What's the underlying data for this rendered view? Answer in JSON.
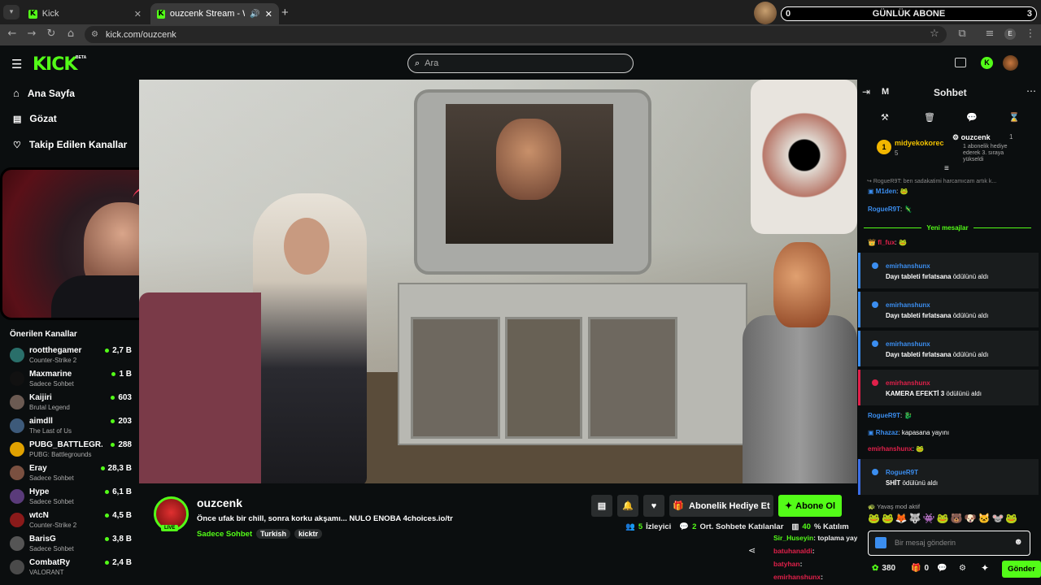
{
  "browser": {
    "tabs": [
      {
        "title": "Kick"
      },
      {
        "title": "ouzcenk Stream - Watch Li"
      }
    ],
    "url": "kick.com/ouzcenk",
    "profile_letter": "E"
  },
  "overlay": {
    "subs_left": "0",
    "subs_title": "GÜNLÜK ABONE",
    "subs_right": "3"
  },
  "header": {
    "logo": "KICK",
    "beta": "BETA",
    "search_placeholder": "Ara"
  },
  "sidebar": {
    "nav": [
      {
        "label": "Ana Sayfa"
      },
      {
        "label": "Gözat"
      },
      {
        "label": "Takip Edilen Kanallar"
      }
    ],
    "recommended_title": "Önerilen Kanallar",
    "channels": [
      {
        "name": "rootthegamer",
        "category": "Counter-Strike 2",
        "viewers": "2,7 B",
        "color": "#2a6f6a"
      },
      {
        "name": "Maxmarine",
        "category": "Sadece Sohbet",
        "viewers": "1 B",
        "color": "#111"
      },
      {
        "name": "Kaijiri",
        "category": "Brutal Legend",
        "viewers": "603",
        "color": "#6b5a52"
      },
      {
        "name": "aimdll",
        "category": "The Last of Us",
        "viewers": "203",
        "color": "#3d5a7a"
      },
      {
        "name": "PUBG_BATTLEGR...",
        "category": "PUBG: Battlegrounds",
        "viewers": "288",
        "color": "#e0a100"
      },
      {
        "name": "Eray",
        "category": "Sadece Sohbet",
        "viewers": "28,3 B",
        "color": "#7a5040"
      },
      {
        "name": "Hype",
        "category": "Sadece Sohbet",
        "viewers": "6,1 B",
        "color": "#5a3b7a"
      },
      {
        "name": "wtcN",
        "category": "Counter-Strike 2",
        "viewers": "4,5 B",
        "color": "#8a1a1a"
      },
      {
        "name": "BarisG",
        "category": "Sadece Sohbet",
        "viewers": "3,8 B",
        "color": "#555"
      },
      {
        "name": "CombatRy",
        "category": "VALORANT",
        "viewers": "2,4 B",
        "color": "#4a4a4a"
      }
    ]
  },
  "stream": {
    "username": "ouzcenk",
    "live": "LIVE",
    "title": "Önce ufak bir chill, sonra korku akşamı... NULO ENOBA 4choices.io/tr",
    "category": "Sadece Sohbet",
    "tags": [
      "Turkish",
      "kicktr"
    ],
    "gift_label": "Abonelik Hediye Et",
    "subscribe_label": "Abone Ol",
    "viewers": "5",
    "viewers_label": "İzleyici",
    "avg_chatters": "2",
    "avg_label": "Ort. Sohbete Katılanlar",
    "participation": "40",
    "participation_label": "% Katılım"
  },
  "chat": {
    "title": "Sohbet",
    "m_label": "M",
    "pinned": {
      "user1": "midyekokorec",
      "n1": "5",
      "user2": "ouzcenk",
      "n2": "1",
      "note": "1 abonelik hediye ederek 3. sıraya yükseldi"
    },
    "reply_preview": "RogueR9T: ben sadakatimi harcamıcam artık k...",
    "msg_m1den": "M1den",
    "msg_rogue1": "RogueR9T",
    "new_messages": "Yeni mesajlar",
    "msg_flux": "fl_fux",
    "rewards": [
      {
        "user": "emirhanshunx",
        "text_bold": "Dayı tableti fırlatsana",
        "text": " ödülünü aldı",
        "color": "#3b8ef0"
      },
      {
        "user": "emirhanshunx",
        "text_bold": "Dayı tableti fırlatsana",
        "text": " ödülünü aldı",
        "color": "#3b8ef0"
      },
      {
        "user": "emirhanshunx",
        "text_bold": "Dayı tableti fırlatsana",
        "text": " ödülünü aldı",
        "color": "#3b8ef0"
      },
      {
        "user": "emirhanshunx",
        "text_bold": "KAMERA EFEKTİ 3",
        "text": " ödülünü aldı",
        "color": "#e0204a"
      }
    ],
    "msg_rogue2": "RogueR9T",
    "msg_rhazaz_user": "Rhazaz",
    "msg_rhazaz_text": "kapasana yayını",
    "msg_emir_user": "emirhanshunx",
    "reward5": {
      "user": "RogueR9T",
      "text_bold": "SHİT",
      "text": " ödülünü aldı"
    },
    "slow_mode": "Yavaş mod aktif",
    "input_placeholder": "Bir mesaj gönderin",
    "points": "380",
    "count": "0",
    "send": "Gönder"
  },
  "overlay_chat": [
    {
      "user": "Sir_Huseyin",
      "text": "toplama yayın",
      "color": "#53fc18"
    },
    {
      "user": "batuhanaldi",
      "text": "",
      "color": "#e0204a"
    },
    {
      "user": "batyhan",
      "text": "",
      "color": "#e0204a"
    },
    {
      "user": "emirhanshunx",
      "text": "",
      "color": "#e0204a"
    }
  ]
}
